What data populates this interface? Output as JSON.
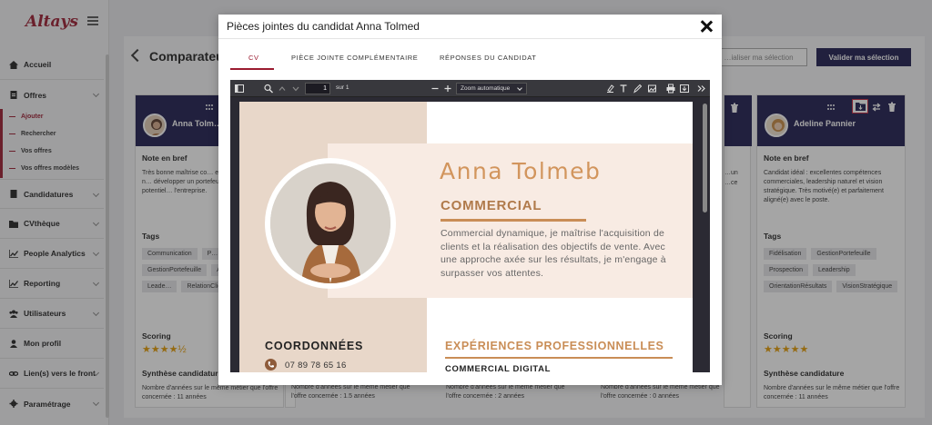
{
  "app": {
    "logo": "Altays"
  },
  "sidebar": {
    "items": [
      {
        "label": "Accueil",
        "icon": "home-icon"
      },
      {
        "label": "Offres",
        "icon": "document-icon"
      },
      {
        "label": "Candidatures",
        "icon": "document-icon"
      },
      {
        "label": "CVthèque",
        "icon": "folder-icon"
      },
      {
        "label": "People Analytics",
        "icon": "chart-icon"
      },
      {
        "label": "Reporting",
        "icon": "chart-icon"
      },
      {
        "label": "Utilisateurs",
        "icon": "users-icon"
      },
      {
        "label": "Mon profil",
        "icon": "user-icon"
      },
      {
        "label": "Lien(s) vers le front",
        "icon": "link-icon"
      },
      {
        "label": "Paramétrage",
        "icon": "gear-icon"
      }
    ],
    "offres_sub": [
      "Ajouter",
      "Rechercher",
      "Vos offres",
      "Vos offres modèles"
    ]
  },
  "page": {
    "title": "Comparateur",
    "btn_secondary": "…ialiser ma sélection",
    "btn_primary": "Valider ma sélection"
  },
  "card_left": {
    "name": "Anna Tolm…",
    "note_title": "Note en bref",
    "note": "Très bonne maîtrise co… excellente capacité à n… développer un portefeu… motivation et potentiel… l'entreprise.",
    "tags_title": "Tags",
    "tags": [
      "Communication",
      "P…",
      "GestionPortefeuille",
      "Autonomie",
      "Leade…",
      "RelationClient"
    ],
    "scoring_title": "Scoring",
    "stars": "★★★★½",
    "synth_title": "Synthèse candidature",
    "synth": "Nombre d'années sur le même métier que l'offre concernée : 11 années"
  },
  "card_right": {
    "name": "Adeline Pannier",
    "note_title": "Note en bref",
    "note": "Candidat idéal : excellentes compétences commerciales, leadership naturel et vision stratégique. Très motivé(e) et parfaitement aligné(e) avec le poste.",
    "tags_title": "Tags",
    "tags": [
      "Fidélisation",
      "GestionPortefeuille",
      "Prospection",
      "Leadership",
      "OrientationRésultats",
      "VisionStratégique"
    ],
    "scoring_title": "Scoring",
    "stars": "★★★★★",
    "synth_title": "Synthèse candidature",
    "synth": "Nombre d'années sur le même métier que l'offre concernée : 11 années"
  },
  "hidden_cards": {
    "fragment_a": "Nombre d'années sur le même métier que l'offre concernée : 1.5 années",
    "fragment_b": "Nombre d'années sur le même métier que l'offre concernée : 2 années",
    "fragment_c": "Nombre d'années sur le même métier que l'offre concernée : 0 années",
    "edge_note_1": "…un",
    "edge_note_2": "…ce"
  },
  "modal": {
    "title": "Pièces jointes du candidat Anna Tolmed",
    "tabs": [
      "CV",
      "PIÈCE JOINTE COMPLÉMENTAIRE",
      "RÉPONSES DU CANDIDAT"
    ],
    "active_tab": 0
  },
  "viewer": {
    "page_number": "1",
    "page_of": "sur 1",
    "zoom": "Zoom automatique"
  },
  "cv": {
    "name": "Anna Tolmeb",
    "role": "COMMERCIAL",
    "summary": "Commercial dynamique, je maîtrise l'acquisition de clients et la réalisation des objectifs de vente. Avec une approche axée sur les résultats, je m'engage à surpasser vos attentes.",
    "contact_title": "COORDONNÉES",
    "phone": "07 89 78 65 16",
    "experience_title": "EXPÉRIENCES PROFESSIONNELLES",
    "job1": "COMMERCIAL DIGITAL"
  },
  "colors": {
    "brand": "#9b1b30",
    "navy": "#1c1a4e",
    "cv_accent": "#d2955d",
    "cv_beige": "#e8d7c9",
    "star": "#e39a00"
  }
}
